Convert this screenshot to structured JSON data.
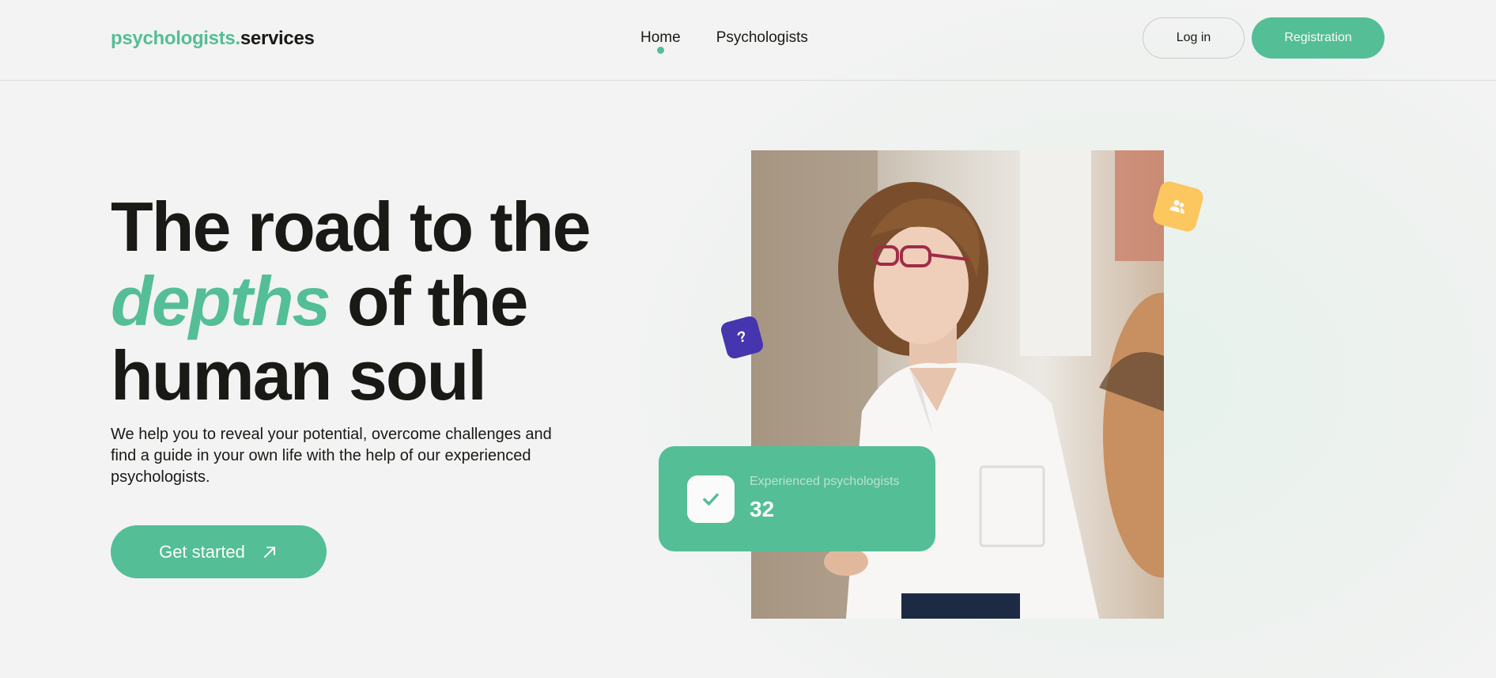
{
  "header": {
    "logo": {
      "brand": "psychologists.",
      "suffix": "services"
    },
    "nav": [
      {
        "label": "Home",
        "active": true
      },
      {
        "label": "Psychologists",
        "active": false
      }
    ],
    "login_label": "Log in",
    "register_label": "Registration"
  },
  "hero": {
    "title_line1": "The road to the",
    "title_accent": "depths",
    "title_line2_rest": "of the",
    "title_line3": "human soul",
    "description": "We help you to reveal your potential, overcome challenges and find a guide in your own life with the help of our experienced psychologists.",
    "cta_label": "Get started"
  },
  "stats": {
    "label": "Experienced psychologists",
    "value": "32"
  },
  "badges": {
    "question": "?"
  },
  "icons": {
    "logo": "wordmark",
    "cta": "arrow-up-right-icon",
    "stat": "check-icon",
    "users": "users-icon",
    "question": "question-icon"
  },
  "colors": {
    "accent": "#54be96",
    "text": "#191a15",
    "yellow": "#fbc75e",
    "purple": "#4535af",
    "background": "#f3f3f3"
  }
}
